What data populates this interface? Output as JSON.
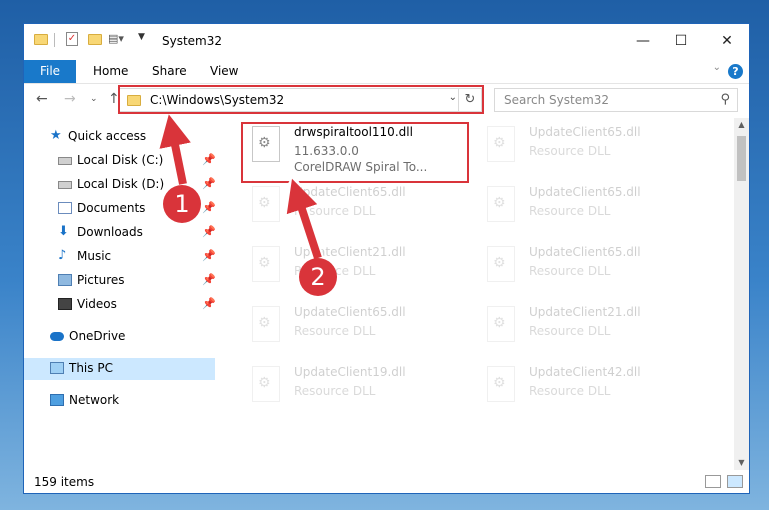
{
  "window": {
    "title": "System32"
  },
  "titlebar": {
    "minimize_glyph": "—",
    "maximize_glyph": "☐",
    "close_glyph": "✕"
  },
  "ribbon": {
    "file_label": "File",
    "tabs": [
      "Home",
      "Share",
      "View"
    ],
    "help_glyph": "?"
  },
  "nav": {
    "address": "C:\\Windows\\System32",
    "search_placeholder": "Search System32"
  },
  "sidebar": {
    "items": [
      {
        "label": "Quick access",
        "icon": "star-icon"
      },
      {
        "label": "Local Disk (C:)",
        "icon": "drive-icon"
      },
      {
        "label": "Local Disk (D:)",
        "icon": "drive-icon"
      },
      {
        "label": "Documents",
        "icon": "documents-icon"
      },
      {
        "label": "Downloads",
        "icon": "downloads-icon"
      },
      {
        "label": "Music",
        "icon": "music-icon"
      },
      {
        "label": "Pictures",
        "icon": "pictures-icon"
      },
      {
        "label": "Videos",
        "icon": "videos-icon"
      },
      {
        "label": "OneDrive",
        "icon": "onedrive-icon"
      },
      {
        "label": "This PC",
        "icon": "this-pc-icon"
      },
      {
        "label": "Network",
        "icon": "network-icon"
      }
    ]
  },
  "files": [
    {
      "name": "drwspiraltool110.dll",
      "line2": "11.633.0.0",
      "line3": "CorelDRAW Spiral To..."
    },
    {
      "name": "UpdateClient65.dll",
      "line2": "Resource DLL"
    },
    {
      "name": "UpdateClient65.dll",
      "line2": "Resource DLL"
    },
    {
      "name": "UpdateClient65.dll",
      "line2": "Resource DLL"
    },
    {
      "name": "UpdateClient21.dll",
      "line2": "Resource DLL"
    },
    {
      "name": "UpdateClient65.dll",
      "line2": "Resource DLL"
    },
    {
      "name": "UpdateClient65.dll",
      "line2": "Resource DLL"
    },
    {
      "name": "UpdateClient21.dll",
      "line2": "Resource DLL"
    },
    {
      "name": "UpdateClient19.dll",
      "line2": "Resource DLL"
    },
    {
      "name": "UpdateClient42.dll",
      "line2": "Resource DLL"
    }
  ],
  "status": {
    "item_count": "159 items"
  },
  "annotations": {
    "badge1": "1",
    "badge2": "2",
    "color": "#d9343a"
  }
}
